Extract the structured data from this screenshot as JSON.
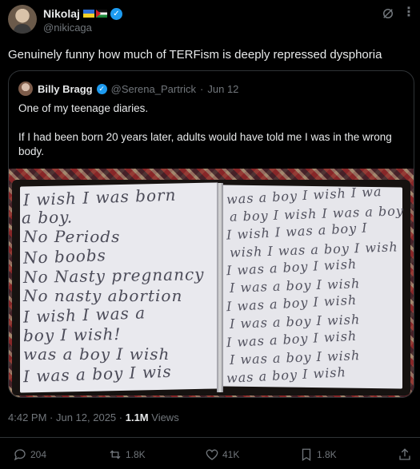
{
  "author": {
    "name": "Nikolaj",
    "handle": "@nikicaga"
  },
  "post": {
    "text": "Genuinely funny how much of TERFism is deeply repressed dysphoria"
  },
  "quote": {
    "name": "Billy Bragg",
    "handle": "@Serena_Partrick",
    "separator": "·",
    "date": "Jun 12",
    "line1": "One of my teenage diaries.",
    "line2": "If I had been born 20 years later, adults would have told me I was in the wrong body."
  },
  "diary": {
    "left": [
      "I wish I was born",
      "a boy.",
      "No Periods",
      "No boobs",
      "No Nasty pregnancy",
      "No nasty abortion",
      "I wish I was a",
      "boy I wish!",
      "was a boy I wish",
      "I was a boy I wis"
    ],
    "right": [
      "was a boy I wish I wa",
      "a boy I wish I was a boy",
      "I wish I was a boy I",
      "wish I was a boy I wish",
      "I was a boy I wish",
      "I was a boy I wish",
      "I was a boy I wish",
      "I was a boy I wish",
      "I was a boy I wish",
      "I was a boy I wish",
      "was a boy I wish"
    ]
  },
  "meta": {
    "time": "4:42 PM",
    "sep1": " · ",
    "date": "Jun 12, 2025",
    "sep2": " · ",
    "views_count": "1.1M",
    "views_label": " Views"
  },
  "actions": {
    "replies": "204",
    "reposts": "1.8K",
    "likes": "41K",
    "bookmarks": "1.8K"
  },
  "icons": [
    "verified-badge-icon",
    "grok-icon",
    "more-icon",
    "reply-icon",
    "repost-icon",
    "like-icon",
    "bookmark-icon",
    "share-icon"
  ],
  "colors": {
    "accent": "#1d9bf0",
    "muted": "#71767b",
    "text": "#e7e9ea",
    "border": "#2f3336"
  }
}
